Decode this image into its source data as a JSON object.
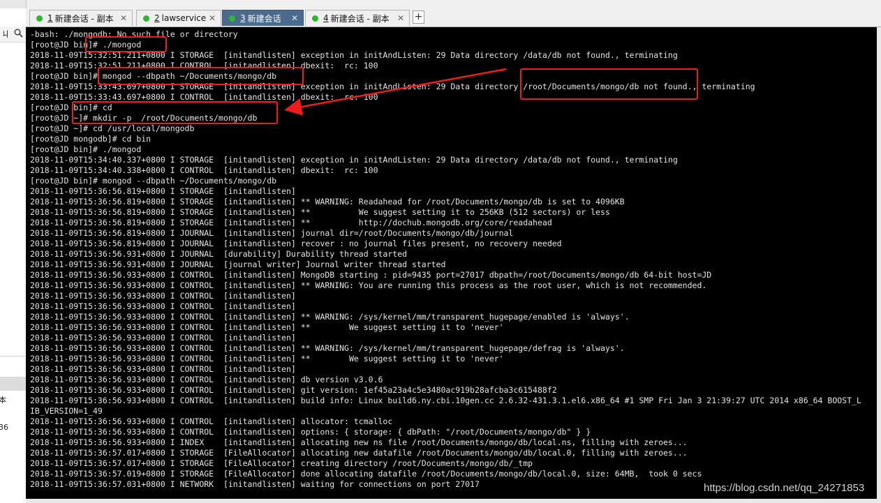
{
  "left_panel": {
    "pin_glyph": "ㄐ",
    "search_icon": "search-icon",
    "fragments": [
      "本",
      "36"
    ]
  },
  "tabs": [
    {
      "number": "1",
      "title": "新建会话 - 副本",
      "active": false,
      "status_color": "#2db82d"
    },
    {
      "number": "2",
      "title": "lawservice",
      "active": false,
      "status_color": "#2db82d"
    },
    {
      "number": "3",
      "title": "新建会话",
      "active": true,
      "status_color": "#2db82d"
    },
    {
      "number": "4",
      "title": "新建会话 - 副本",
      "active": false,
      "status_color": "#2db82d"
    }
  ],
  "tab_close_glyph": "✕",
  "add_tab_glyph": "+",
  "terminal": {
    "lines": [
      "-bash: ./mongodb: No such file or directory",
      "[root@JD bin]# ./mongod",
      "2018-11-09T15:32:51.211+0800 I STORAGE  [initandlisten] exception in initAndListen: 29 Data directory /data/db not found., terminating",
      "2018-11-09T15:32:51.211+0800 I CONTROL  [initandlisten] dbexit:  rc: 100",
      "[root@JD bin]# mongod --dbpath ~/Documents/mongo/db",
      "2018-11-09T15:33:43.697+0800 I STORAGE  [initandlisten] exception in initAndListen: 29 Data directory /root/Documents/mongo/db not found., terminating",
      "2018-11-09T15:33:43.697+0800 I CONTROL  [initandlisten] dbexit:  rc: 100",
      "[root@JD bin]# cd",
      "[root@JD ~]# mkdir -p  /root/Documents/mongo/db",
      "[root@JD ~]# cd /usr/local/mongodb",
      "[root@JD mongodb]# cd bin",
      "[root@JD bin]# ./mongod",
      "2018-11-09T15:34:40.337+0800 I STORAGE  [initandlisten] exception in initAndListen: 29 Data directory /data/db not found., terminating",
      "2018-11-09T15:34:40.338+0800 I CONTROL  [initandlisten] dbexit:  rc: 100",
      "[root@JD bin]# mongod --dbpath ~/Documents/mongo/db",
      "2018-11-09T15:36:56.819+0800 I STORAGE  [initandlisten]",
      "2018-11-09T15:36:56.819+0800 I STORAGE  [initandlisten] ** WARNING: Readahead for /root/Documents/mongo/db is set to 4096KB",
      "2018-11-09T15:36:56.819+0800 I STORAGE  [initandlisten] **          We suggest setting it to 256KB (512 sectors) or less",
      "2018-11-09T15:36:56.819+0800 I STORAGE  [initandlisten] **          http://dochub.mongodb.org/core/readahead",
      "2018-11-09T15:36:56.819+0800 I JOURNAL  [initandlisten] journal dir=/root/Documents/mongo/db/journal",
      "2018-11-09T15:36:56.819+0800 I JOURNAL  [initandlisten] recover : no journal files present, no recovery needed",
      "2018-11-09T15:36:56.931+0800 I JOURNAL  [durability] Durability thread started",
      "2018-11-09T15:36:56.931+0800 I JOURNAL  [journal writer] Journal writer thread started",
      "2018-11-09T15:36:56.933+0800 I CONTROL  [initandlisten] MongoDB starting : pid=9435 port=27017 dbpath=/root/Documents/mongo/db 64-bit host=JD",
      "2018-11-09T15:36:56.933+0800 I CONTROL  [initandlisten] ** WARNING: You are running this process as the root user, which is not recommended.",
      "2018-11-09T15:36:56.933+0800 I CONTROL  [initandlisten]",
      "2018-11-09T15:36:56.933+0800 I CONTROL  [initandlisten]",
      "2018-11-09T15:36:56.933+0800 I CONTROL  [initandlisten] ** WARNING: /sys/kernel/mm/transparent_hugepage/enabled is 'always'.",
      "2018-11-09T15:36:56.933+0800 I CONTROL  [initandlisten] **        We suggest setting it to 'never'",
      "2018-11-09T15:36:56.933+0800 I CONTROL  [initandlisten]",
      "2018-11-09T15:36:56.933+0800 I CONTROL  [initandlisten] ** WARNING: /sys/kernel/mm/transparent_hugepage/defrag is 'always'.",
      "2018-11-09T15:36:56.933+0800 I CONTROL  [initandlisten] **        We suggest setting it to 'never'",
      "2018-11-09T15:36:56.933+0800 I CONTROL  [initandlisten]",
      "2018-11-09T15:36:56.933+0800 I CONTROL  [initandlisten] db version v3.0.6",
      "2018-11-09T15:36:56.933+0800 I CONTROL  [initandlisten] git version: 1ef45a23a4c5e3480ac919b28afcba3c615488f2",
      "2018-11-09T15:36:56.933+0800 I CONTROL  [initandlisten] build info: Linux build6.ny.cbi.10gen.cc 2.6.32-431.3.1.el6.x86_64 #1 SMP Fri Jan 3 21:39:27 UTC 2014 x86_64 BOOST_L",
      "IB_VERSION=1_49",
      "2018-11-09T15:36:56.933+0800 I CONTROL  [initandlisten] allocator: tcmalloc",
      "2018-11-09T15:36:56.933+0800 I CONTROL  [initandlisten] options: { storage: { dbPath: \"/root/Documents/mongo/db\" } }",
      "2018-11-09T15:36:56.933+0800 I INDEX    [initandlisten] allocating new ns file /root/Documents/mongo/db/local.ns, filling with zeroes...",
      "2018-11-09T15:36:57.017+0800 I STORAGE  [FileAllocator] allocating new datafile /root/Documents/mongo/db/local.0, filling with zeroes...",
      "2018-11-09T15:36:57.017+0800 I STORAGE  [FileAllocator] creating directory /root/Documents/mongo/db/_tmp",
      "2018-11-09T15:36:57.019+0800 I STORAGE  [FileAllocator] done allocating datafile /root/Documents/mongo/db/local.0, size: 64MB,  took 0 secs",
      "2018-11-09T15:36:57.031+0800 I NETWORK  [initandlisten] waiting for connections on port 27017"
    ]
  },
  "watermark": "https://blog.csdn.net/qq_24271853",
  "colors": {
    "terminal_bg": "#000000",
    "terminal_fg": "#e4e4e4",
    "annotation_red": "#ee1c1c",
    "active_tab": "#4b6a8e"
  }
}
